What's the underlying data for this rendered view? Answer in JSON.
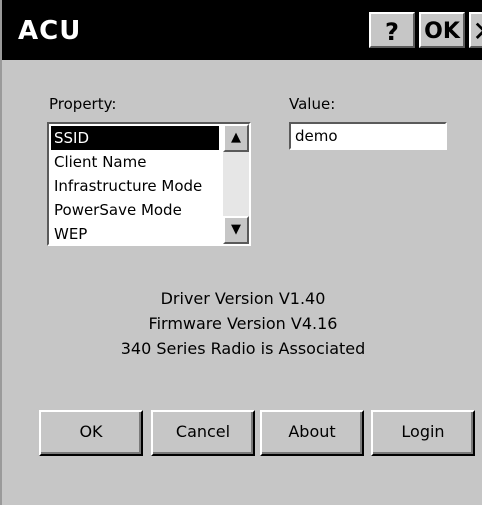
{
  "window": {
    "title": "ACU",
    "help_label": "?",
    "ok_label": "OK",
    "close_label": "✕"
  },
  "property": {
    "label": "Property:",
    "items": [
      {
        "label": "SSID",
        "selected": true
      },
      {
        "label": "Client Name",
        "selected": false
      },
      {
        "label": "Infrastructure Mode",
        "selected": false
      },
      {
        "label": "PowerSave Mode",
        "selected": false
      },
      {
        "label": "WEP",
        "selected": false
      }
    ],
    "scroll_up_icon": "▲",
    "scroll_down_icon": "▼"
  },
  "value": {
    "label": "Value:",
    "input_value": "demo"
  },
  "status": {
    "driver": "Driver Version V1.40",
    "firmware": "Firmware Version V4.16",
    "radio": "340 Series Radio is Associated"
  },
  "buttons": {
    "ok": "OK",
    "cancel": "Cancel",
    "about": "About",
    "login": "Login"
  },
  "colors": {
    "titlebar": "#000000",
    "dialog_bg": "#c6c6c6",
    "selection": "#000000"
  }
}
